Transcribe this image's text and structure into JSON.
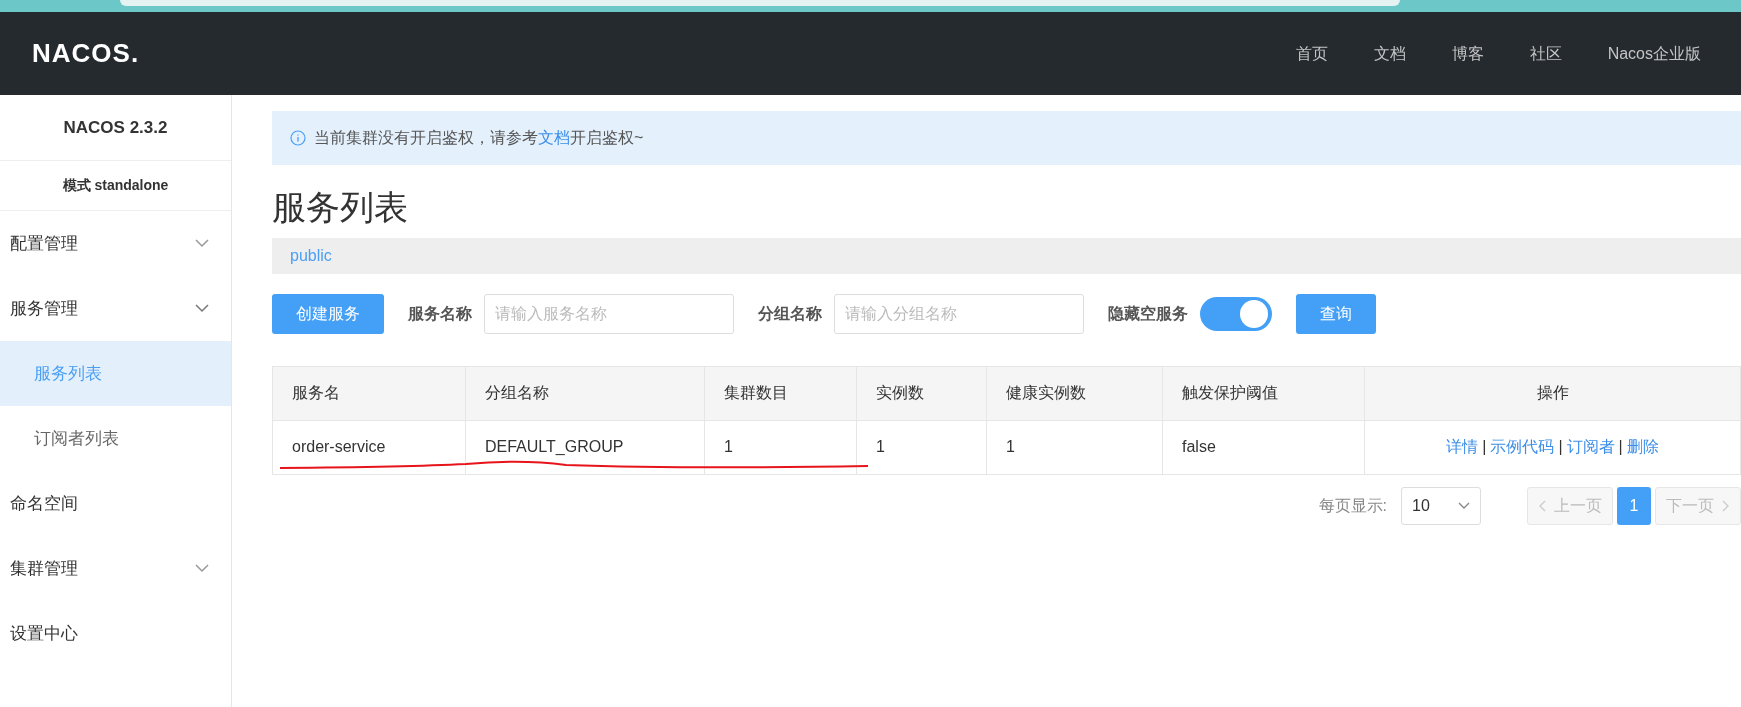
{
  "header": {
    "logo": "NACOS.",
    "nav": [
      {
        "label": "首页"
      },
      {
        "label": "文档"
      },
      {
        "label": "博客"
      },
      {
        "label": "社区"
      },
      {
        "label": "Nacos企业版"
      }
    ]
  },
  "sidebar": {
    "version": "NACOS 2.3.2",
    "mode": "模式 standalone",
    "items": [
      {
        "label": "配置管理",
        "kind": "submenu",
        "expanded": false
      },
      {
        "label": "服务管理",
        "kind": "submenu",
        "expanded": true,
        "children": [
          {
            "label": "服务列表",
            "selected": true
          },
          {
            "label": "订阅者列表",
            "selected": false
          }
        ]
      },
      {
        "label": "命名空间",
        "kind": "item"
      },
      {
        "label": "集群管理",
        "kind": "submenu",
        "expanded": false
      },
      {
        "label": "设置中心",
        "kind": "item"
      }
    ]
  },
  "alert": {
    "text_before": "当前集群没有开启鉴权，请参考",
    "link": "文档",
    "text_after": "开启鉴权~"
  },
  "page_title": "服务列表",
  "namespace": "public",
  "filters": {
    "create_button": "创建服务",
    "service_name_label": "服务名称",
    "service_name": {
      "placeholder": "请输入服务名称"
    },
    "group_name_label": "分组名称",
    "group_name": {
      "placeholder": "请输入分组名称"
    },
    "hide_empty_label": "隐藏空服务",
    "hide_empty": {
      "on": true
    },
    "query_button": "查询"
  },
  "table": {
    "columns": [
      "服务名",
      "分组名称",
      "集群数目",
      "实例数",
      "健康实例数",
      "触发保护阈值",
      "操作"
    ],
    "rows": [
      {
        "cells": [
          "order-service",
          "DEFAULT_GROUP",
          "1",
          "1",
          "1",
          "false"
        ],
        "actions": [
          "详情",
          "示例代码",
          "订阅者",
          "删除"
        ]
      }
    ],
    "action_separator": "|"
  },
  "pagination": {
    "page_size_label": "每页显示:",
    "page_size": "10",
    "prev": {
      "label": "上一页",
      "disabled": true
    },
    "pages": [
      {
        "label": "1",
        "selected": true
      }
    ],
    "next": {
      "label": "下一页",
      "disabled": true
    }
  }
}
